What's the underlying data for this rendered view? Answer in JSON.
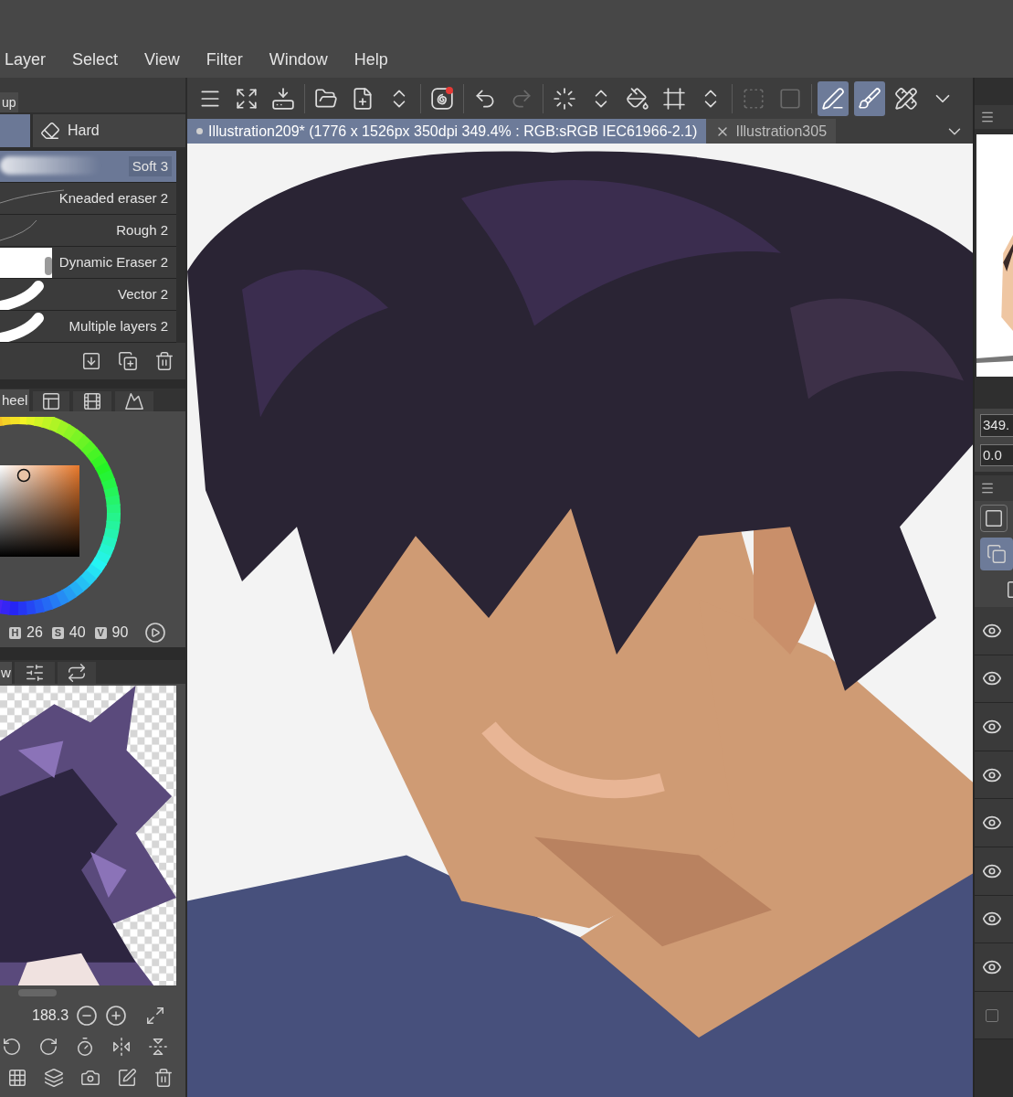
{
  "menu": [
    "Layer",
    "Select",
    "View",
    "Filter",
    "Window",
    "Help"
  ],
  "toolbar": [
    {
      "selected": false,
      "disabled": false
    },
    {
      "selected": false,
      "disabled": false
    },
    {
      "selected": false,
      "disabled": false
    },
    {
      "selected": false,
      "disabled": false
    },
    {
      "selected": false,
      "disabled": false
    },
    {
      "selected": false,
      "disabled": false
    },
    {
      "selected": false,
      "disabled": false,
      "badge": true
    },
    {
      "selected": false,
      "disabled": false
    },
    {
      "selected": false,
      "disabled": true
    },
    {
      "selected": false,
      "disabled": false
    },
    {
      "selected": false,
      "disabled": false
    },
    {
      "selected": false,
      "disabled": false
    },
    {
      "selected": false,
      "disabled": false
    },
    {
      "selected": false,
      "disabled": false
    },
    {
      "selected": false,
      "disabled": true
    },
    {
      "selected": false,
      "disabled": true
    },
    {
      "selected": true,
      "disabled": false
    },
    {
      "selected": true,
      "disabled": false
    },
    {
      "selected": false,
      "disabled": false
    },
    {
      "selected": false,
      "disabled": false
    }
  ],
  "document_tabs": [
    {
      "label": "Illustration209* (1776 x 1526px 350dpi 349.4% : RGB:sRGB IEC61966-2.1)",
      "selected": true
    },
    {
      "label": "Illustration305",
      "selected": false
    }
  ],
  "sub_tool": {
    "group_tab": "up",
    "tabs": [
      {
        "selected": true
      },
      {
        "label": "Hard",
        "selected": false
      }
    ]
  },
  "brushes": [
    {
      "label": "Soft 3",
      "selected": true
    },
    {
      "label": "Kneaded eraser 2",
      "selected": false
    },
    {
      "label": "Rough 2",
      "selected": false
    },
    {
      "label": "Dynamic Eraser 2",
      "selected": false
    },
    {
      "label": "Vector 2",
      "selected": false
    },
    {
      "label": "Multiple layers 2",
      "selected": false
    }
  ],
  "color": {
    "tab": "heel",
    "readouts": [
      {
        "key": "H",
        "value": "26"
      },
      {
        "key": "S",
        "value": "40"
      },
      {
        "key": "V",
        "value": "90"
      }
    ]
  },
  "navigator": {
    "tab": "w",
    "zoom": "188.3"
  },
  "right_panel": {
    "zoom": "349.",
    "angle": "0.0",
    "layers": [
      {
        "visible": true
      },
      {
        "visible": true
      },
      {
        "visible": true
      },
      {
        "visible": true
      },
      {
        "visible": true
      },
      {
        "visible": true
      },
      {
        "visible": true
      },
      {
        "visible": true
      },
      {
        "visible": false
      }
    ]
  }
}
